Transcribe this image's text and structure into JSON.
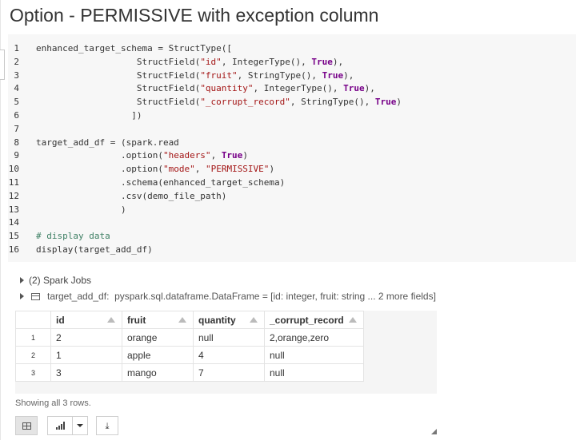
{
  "cell": {
    "title": "Option - PERMISSIVE with exception column"
  },
  "code": {
    "lines": [
      {
        "n": "1",
        "tokens": [
          {
            "t": "plain",
            "s": "enhanced_target_schema = StructType(["
          }
        ]
      },
      {
        "n": "2",
        "tokens": [
          {
            "t": "plain",
            "s": "                   StructField("
          },
          {
            "t": "str",
            "s": "\"id\""
          },
          {
            "t": "plain",
            "s": ", IntegerType(), "
          },
          {
            "t": "kw",
            "s": "True"
          },
          {
            "t": "plain",
            "s": "),"
          }
        ]
      },
      {
        "n": "3",
        "tokens": [
          {
            "t": "plain",
            "s": "                   StructField("
          },
          {
            "t": "str",
            "s": "\"fruit\""
          },
          {
            "t": "plain",
            "s": ", StringType(), "
          },
          {
            "t": "kw",
            "s": "True"
          },
          {
            "t": "plain",
            "s": "),"
          }
        ]
      },
      {
        "n": "4",
        "tokens": [
          {
            "t": "plain",
            "s": "                   StructField("
          },
          {
            "t": "str",
            "s": "\"quantity\""
          },
          {
            "t": "plain",
            "s": ", IntegerType(), "
          },
          {
            "t": "kw",
            "s": "True"
          },
          {
            "t": "plain",
            "s": "),"
          }
        ]
      },
      {
        "n": "5",
        "tokens": [
          {
            "t": "plain",
            "s": "                   StructField("
          },
          {
            "t": "str",
            "s": "\"_corrupt_record\""
          },
          {
            "t": "plain",
            "s": ", StringType(), "
          },
          {
            "t": "kw",
            "s": "True"
          },
          {
            "t": "plain",
            "s": ")"
          }
        ]
      },
      {
        "n": "6",
        "tokens": [
          {
            "t": "plain",
            "s": "                  ])"
          }
        ]
      },
      {
        "n": "7",
        "tokens": []
      },
      {
        "n": "8",
        "tokens": [
          {
            "t": "plain",
            "s": "target_add_df = (spark.read"
          }
        ]
      },
      {
        "n": "9",
        "tokens": [
          {
            "t": "plain",
            "s": "                .option("
          },
          {
            "t": "str",
            "s": "\"headers\""
          },
          {
            "t": "plain",
            "s": ", "
          },
          {
            "t": "kw",
            "s": "True"
          },
          {
            "t": "plain",
            "s": ")"
          }
        ]
      },
      {
        "n": "10",
        "tokens": [
          {
            "t": "plain",
            "s": "                .option("
          },
          {
            "t": "str",
            "s": "\"mode\""
          },
          {
            "t": "plain",
            "s": ", "
          },
          {
            "t": "str",
            "s": "\"PERMISSIVE\""
          },
          {
            "t": "plain",
            "s": ")"
          }
        ]
      },
      {
        "n": "11",
        "tokens": [
          {
            "t": "plain",
            "s": "                .schema(enhanced_target_schema)"
          }
        ]
      },
      {
        "n": "12",
        "tokens": [
          {
            "t": "plain",
            "s": "                .csv(demo_file_path)"
          }
        ]
      },
      {
        "n": "13",
        "tokens": [
          {
            "t": "plain",
            "s": "                )"
          }
        ]
      },
      {
        "n": "14",
        "tokens": []
      },
      {
        "n": "15",
        "tokens": [
          {
            "t": "com",
            "s": "# display data"
          }
        ]
      },
      {
        "n": "16",
        "tokens": [
          {
            "t": "plain",
            "s": "display(target_add_df)"
          }
        ]
      }
    ]
  },
  "output": {
    "spark_jobs": "(2) Spark Jobs",
    "df_name": "target_add_df:",
    "df_type": "pyspark.sql.dataframe.DataFrame = [id: integer, fruit: string ... 2 more fields]",
    "table": {
      "columns": [
        "id",
        "fruit",
        "quantity",
        "_corrupt_record"
      ],
      "rows": [
        {
          "idx": "1",
          "cells": [
            "2",
            "orange",
            "null",
            "2,orange,zero"
          ]
        },
        {
          "idx": "2",
          "cells": [
            "1",
            "apple",
            "4",
            "null"
          ]
        },
        {
          "idx": "3",
          "cells": [
            "3",
            "mango",
            "7",
            "null"
          ]
        }
      ]
    },
    "showing": "Showing all 3 rows."
  },
  "toolbar": {
    "buttons": [
      {
        "name": "table-view-button",
        "icon": "table-icon",
        "active": true
      },
      {
        "name": "chart-view-button",
        "icon": "bar-chart-icon",
        "active": false
      },
      {
        "name": "chart-options-dropdown",
        "icon": "caret-down-icon",
        "active": false
      },
      {
        "name": "download-button",
        "icon": "download-icon",
        "active": false
      }
    ]
  },
  "colors": {
    "string": "#a31515",
    "keyword": "#770088",
    "comment": "#3d7f63",
    "code_bg": "#f7f7f7"
  }
}
